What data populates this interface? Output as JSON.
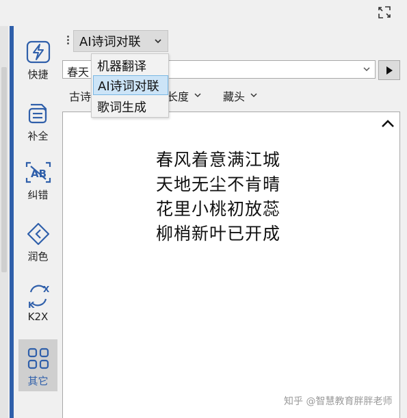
{
  "toolbar": {
    "mode_selected": "AI诗词对联",
    "input_value": "春天"
  },
  "sidebar": {
    "items": [
      {
        "label": "快捷",
        "icon": "lightning-icon"
      },
      {
        "label": "补全",
        "icon": "complete-icon"
      },
      {
        "label": "纠错",
        "icon": "correct-icon"
      },
      {
        "label": "润色",
        "icon": "polish-icon"
      },
      {
        "label": "K2X",
        "icon": "k2x-icon"
      },
      {
        "label": "其它",
        "icon": "grid-icon"
      }
    ],
    "active_index": 5
  },
  "menu": {
    "items": [
      "机器翻译",
      "AI诗词对联",
      "歌词生成"
    ],
    "selected_index": 1
  },
  "options": {
    "style_label": "古诗",
    "length_label": "长度",
    "acrostic_label": "藏头"
  },
  "output": {
    "lines": [
      "春风着意满江城",
      "天地无尘不肯晴",
      "花里小桃初放蕊",
      "柳梢新叶已开成"
    ]
  },
  "watermark": "知乎 @智慧教育胖胖老师",
  "colors": {
    "accent": "#2f5faa",
    "selection_bg": "#cce4f7",
    "selection_border": "#79b7e4"
  }
}
